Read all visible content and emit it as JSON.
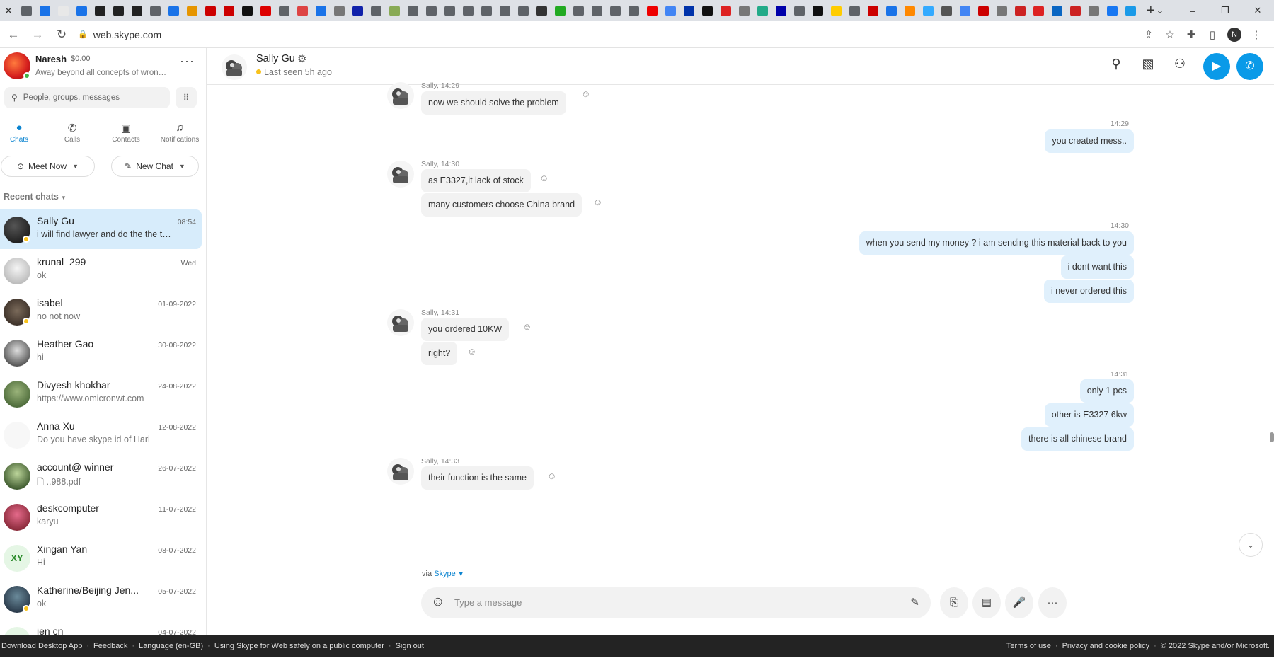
{
  "browser": {
    "url": "web.skype.com",
    "profile_initial": "N",
    "tab_icon_colors": [
      "#5f6368",
      "#1a73e8",
      "#e8e8e8",
      "#1a73e8",
      "#222",
      "#222",
      "#222",
      "#5f6368",
      "#1a73e8",
      "#e69500",
      "#c00",
      "#c00",
      "#111",
      "#d00",
      "#5f6368",
      "#d44",
      "#1a73e8",
      "#777",
      "#12a",
      "#5f6368",
      "#8a5",
      "#5f6368",
      "#5f6368",
      "#5f6368",
      "#5f6368",
      "#5f6368",
      "#5f6368",
      "#5f6368",
      "#333",
      "#2a2",
      "#5f6368",
      "#5f6368",
      "#5f6368",
      "#5f6368",
      "#e00",
      "#4285f4",
      "#03a",
      "#111",
      "#d22",
      "#777",
      "#2a8",
      "#00a",
      "#5f6368",
      "#111",
      "#fc0",
      "#5f6368",
      "#c00",
      "#1a73e8",
      "#f80",
      "#3af",
      "#555",
      "#4285f4",
      "#c00",
      "#777",
      "#c22",
      "#d22",
      "#0a66c2",
      "#c22",
      "#777",
      "#1877f2",
      "#1a9ae8"
    ],
    "new_tab": "+",
    "window_controls": [
      "⌄",
      "–",
      "❐",
      "✕"
    ]
  },
  "sidebar": {
    "profile": {
      "name": "Naresh",
      "balance": "$0.00",
      "mood": "Away beyond all concepts of wrong-doing and right-doing"
    },
    "search_placeholder": "People, groups, messages",
    "nav": [
      {
        "label": "Chats",
        "icon": "chat-icon"
      },
      {
        "label": "Calls",
        "icon": "phone-icon"
      },
      {
        "label": "Contacts",
        "icon": "contacts-icon"
      },
      {
        "label": "Notifications",
        "icon": "bell-icon"
      }
    ],
    "meet_now": "Meet Now",
    "new_chat": "New Chat",
    "recent_label": "Recent chats",
    "chats": [
      {
        "name": "Sally Gu",
        "time": "08:54",
        "preview": "i will find lawyer and do the the the rest",
        "active": true
      },
      {
        "name": "krunal_299",
        "time": "Wed",
        "preview": "ok"
      },
      {
        "name": "isabel",
        "time": "01-09-2022",
        "preview": "no not now"
      },
      {
        "name": "Heather Gao",
        "time": "30-08-2022",
        "preview": "hi"
      },
      {
        "name": "Divyesh khokhar",
        "time": "24-08-2022",
        "preview": "https://www.omicronwt.com"
      },
      {
        "name": "Anna Xu",
        "time": "12-08-2022",
        "preview": "Do you have skype id of Hari"
      },
      {
        "name": "account@ winner",
        "time": "26-07-2022",
        "preview": "..988.pdf"
      },
      {
        "name": "deskcomputer",
        "time": "11-07-2022",
        "preview": "karyu"
      },
      {
        "name": "Xingan  Yan",
        "time": "08-07-2022",
        "preview": "Hi",
        "initials": "XY"
      },
      {
        "name": "Katherine/Beijing Jen...",
        "time": "05-07-2022",
        "preview": "ok"
      },
      {
        "name": "jen cn",
        "time": "04-07-2022",
        "preview": ""
      }
    ]
  },
  "chat": {
    "name": "Sally Gu",
    "last_seen": "Last seen 5h ago",
    "messages": [
      {
        "dir": "in",
        "meta": "Sally, 14:29",
        "text": "now we should solve the problem"
      },
      {
        "dir": "out",
        "meta": "14:29",
        "text": "you created mess.."
      },
      {
        "dir": "in",
        "meta": "Sally, 14:30",
        "text": "as E3327,it lack of stock"
      },
      {
        "dir": "in",
        "text": "many customers choose China brand"
      },
      {
        "dir": "out",
        "meta": "14:30",
        "text": "when you send my money ? i am sending this material back to you"
      },
      {
        "dir": "out",
        "text": "i dont want this"
      },
      {
        "dir": "out",
        "text": "i never ordered this"
      },
      {
        "dir": "in",
        "meta": "Sally, 14:31",
        "text": "you ordered 10KW"
      },
      {
        "dir": "in",
        "text": "right?"
      },
      {
        "dir": "out",
        "meta": "14:31",
        "text": "only 1 pcs"
      },
      {
        "dir": "out",
        "text": "other is E3327 6kw"
      },
      {
        "dir": "out",
        "text": "there is all chinese brand"
      },
      {
        "dir": "in",
        "meta": "Sally, 14:33",
        "text": "their function is the same"
      }
    ],
    "via_prefix": "via",
    "via_link": "Skype",
    "composer_placeholder": "Type a message"
  },
  "footer": {
    "left": [
      "Download Desktop App",
      "Feedback",
      "Language (en-GB)",
      "Using Skype for Web safely on a public computer",
      "Sign out"
    ],
    "right": [
      "Terms of use",
      "Privacy and cookie policy",
      "© 2022 Skype and/or Microsoft."
    ]
  },
  "colors": {
    "accent": "#0a9ae8",
    "selected_chat": "#d7ecfb",
    "outgoing_bubble": "#e0f0fc",
    "incoming_bubble": "#f2f2f2",
    "away_status": "#f8c21c",
    "online_status": "#41b346"
  }
}
